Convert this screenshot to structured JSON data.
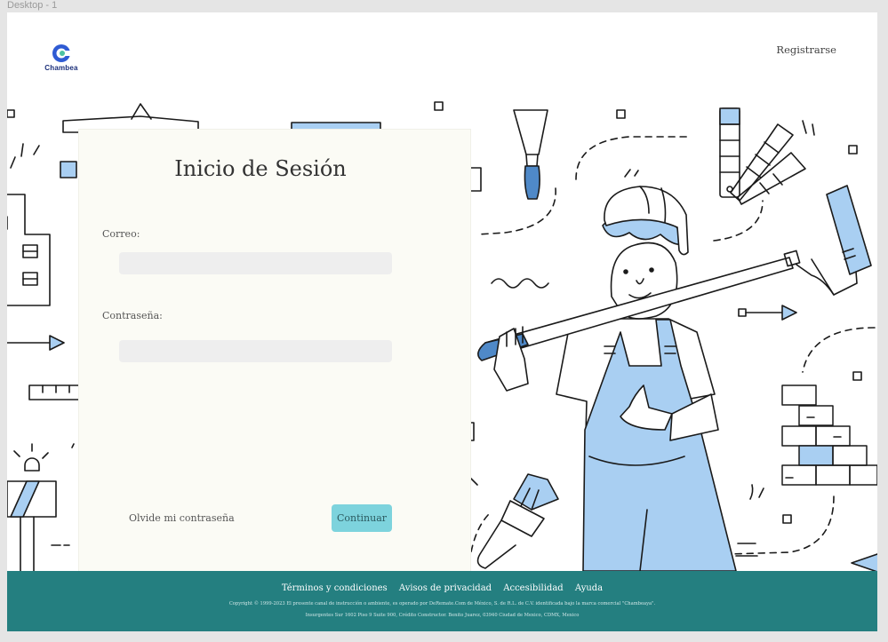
{
  "frame_label": "Desktop - 1",
  "logo": {
    "text": "Chambea"
  },
  "header": {
    "register_label": "Registrarse"
  },
  "login": {
    "title": "Inicio de Sesión",
    "email_label": "Correo:",
    "email_value": "",
    "password_label": "Contraseña:",
    "password_value": "",
    "forgot_label": "Olvide mi contraseña",
    "continue_label": "Continuar"
  },
  "footer": {
    "links": [
      "Términos y condiciones",
      "Avisos de privacidad",
      "Accesibilidad",
      "Ayuda"
    ],
    "copyright": "Copyright © 1999-2023 El presente canal de instrucción o ambiente, es operado por DeRemate.Com de México, S. de R.L. de C.V. identificada bajo la marca comercial \"Chambeaya\".",
    "address": "Insurgentes Sur 1602 Piso 9 Suite 900, Crédito Constructor. Benito Juarez, 03940 Ciudad de Mexico, CDMX, Mexico"
  },
  "colors": {
    "accent": "#7dd3dd",
    "footer": "#247f80",
    "illustration_blue": "#a9cff2",
    "card": "#fbfbf5"
  }
}
